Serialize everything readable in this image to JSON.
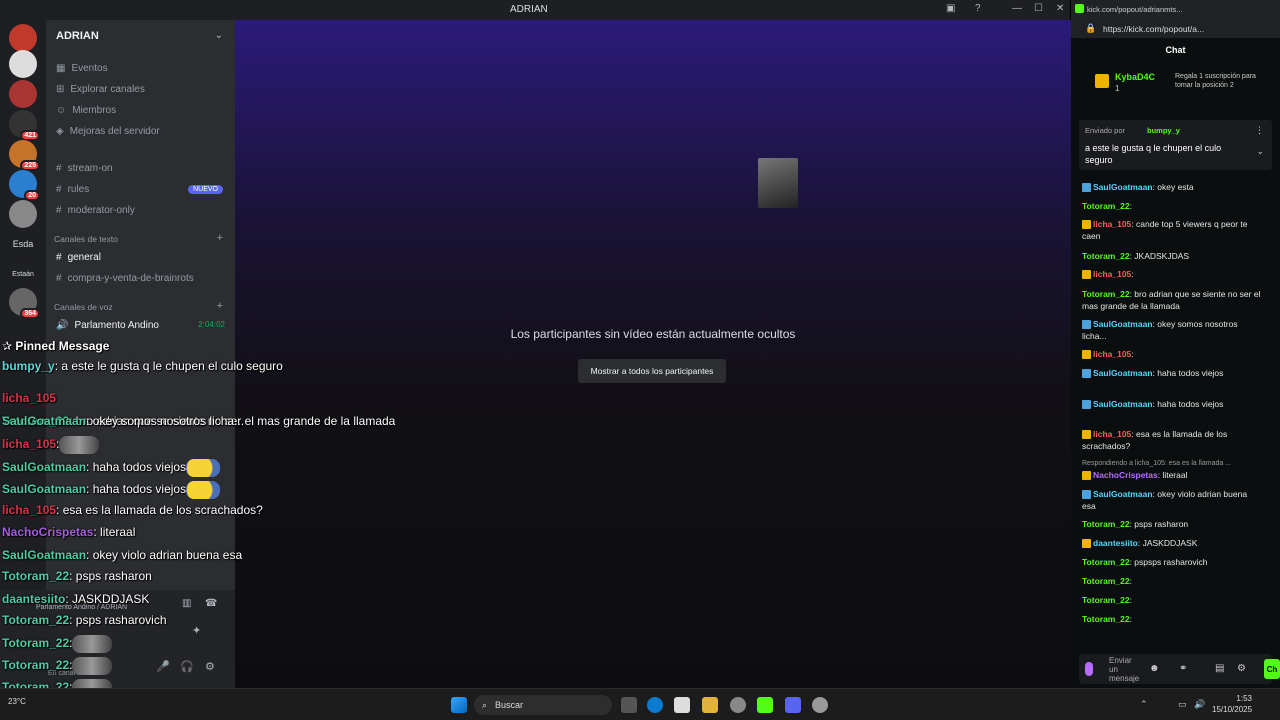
{
  "window": {
    "title": "ADRIAN"
  },
  "rail": {
    "badges": [
      "421",
      "225",
      "20",
      "364"
    ],
    "labels": [
      "Esda",
      "Estaán"
    ]
  },
  "sidebar": {
    "server_name": "ADRIAN",
    "top_items": [
      "Eventos",
      "Explorar canales",
      "Miembros",
      "Mejoras del servidor"
    ],
    "channels": [
      "stream-on",
      "rules",
      "moderator-only"
    ],
    "new_badge": "NUEVO",
    "text_category": "Canales de texto",
    "text_channels": [
      "general",
      "compra-y-venta-de-brainrots"
    ],
    "voice_category": "Canales de voz",
    "voice_channel": "Parlamento Andino",
    "voice_timer": "2:04:02",
    "voice_status": "Parlamento Andino / ADRIAN",
    "voice_sub": "En canal de voz"
  },
  "main": {
    "hidden_text": "Los participantes sin vídeo están actualmente ocultos",
    "show_button": "Mostrar a todos los participantes"
  },
  "overlay": {
    "title": "Pinned Message",
    "lines": [
      {
        "user": "bumpy_y",
        "cls": "u-b",
        "text": ": a este le gusta q le chupen el culo seguro"
      },
      {
        "user": "licha_105",
        "cls": "u-l",
        "text": ""
      },
      {
        "user": "Totoram_22",
        "cls": "u-t",
        "text": ": bro adrian que se siente no ser el mas grande de la llamada"
      },
      {
        "user": "SaulGoatmaan",
        "cls": "u-s",
        "text": ": okey somos nosotros licha..."
      },
      {
        "user": "licha_105",
        "cls": "u-l",
        "text": ":"
      },
      {
        "user": "SaulGoatmaan",
        "cls": "u-s",
        "text": ": haha todos viejos"
      },
      {
        "user": "SaulGoatmaan",
        "cls": "u-s",
        "text": ": haha todos viejos"
      },
      {
        "user": "licha_105",
        "cls": "u-l",
        "text": ": esa es la llamada de los scrachados?"
      },
      {
        "user": "NachoCrispetas",
        "cls": "u-n",
        "text": ": literaal"
      },
      {
        "user": "SaulGoatmaan",
        "cls": "u-s",
        "text": ": okey violo adrian buena esa"
      },
      {
        "user": "Totoram_22",
        "cls": "u-t",
        "text": ": psps rasharon"
      },
      {
        "user": "daantesiito",
        "cls": "u-d",
        "text": ": JASKDDJASK"
      },
      {
        "user": "Totoram_22",
        "cls": "u-t",
        "text": ": psps rasharovich"
      },
      {
        "user": "Totoram_22",
        "cls": "u-t",
        "text": ":"
      },
      {
        "user": "Totoram_22",
        "cls": "u-t",
        "text": ":"
      },
      {
        "user": "Totoram_22",
        "cls": "u-t",
        "text": ":"
      }
    ]
  },
  "kick": {
    "url": "https://kick.com/popout/a...",
    "tab_title": "kick.com/popout/adrianmts...",
    "header": "Chat",
    "top_user": "KybaD4C",
    "top_count": "1",
    "gift_text": "Regala 1 suscripción para tomar la posición 2",
    "pinned_by_label": "Enviado por",
    "pinned_by": "bumpy_y",
    "pinned_text": "a este le gusta q le chupen el culo seguro",
    "messages": [
      {
        "user": "SaulGoatmaan",
        "cls": "kn-s",
        "icon": "blue",
        "text": ": okey esta"
      },
      {
        "user": "Totoram_22",
        "cls": "kn-t",
        "icon": "",
        "text": ":"
      },
      {
        "user": "licha_105",
        "cls": "kn-l",
        "icon": "gold",
        "text": ": cande top 5 viewers q peor te caen"
      },
      {
        "user": "Totoram_22",
        "cls": "kn-t",
        "icon": "",
        "text": ": JKADSKJDAS"
      },
      {
        "user": "licha_105",
        "cls": "kn-l",
        "icon": "gold",
        "text": ":"
      },
      {
        "user": "Totoram_22",
        "cls": "kn-t",
        "icon": "",
        "text": ": bro adrian que se siente no ser el mas grande de la llamada"
      },
      {
        "user": "SaulGoatmaan",
        "cls": "kn-s",
        "icon": "blue",
        "text": ": okey somos nosotros licha..."
      },
      {
        "user": "licha_105",
        "cls": "kn-l",
        "icon": "gold",
        "text": ":"
      },
      {
        "user": "SaulGoatmaan",
        "cls": "kn-s",
        "icon": "blue",
        "text": ": haha todos viejos"
      },
      {
        "user": "SaulGoatmaan",
        "cls": "kn-s",
        "icon": "blue",
        "text": ": haha todos viejos"
      },
      {
        "user": "licha_105",
        "cls": "kn-l",
        "icon": "gold",
        "text": ": esa es la llamada de los scrachados?"
      },
      {
        "user": "NachoCrispetas",
        "cls": "kn-n",
        "icon": "gold",
        "text": ": literaal"
      },
      {
        "user": "SaulGoatmaan",
        "cls": "kn-s",
        "icon": "blue",
        "text": ": okey violo adrian buena esa"
      },
      {
        "user": "Totoram_22",
        "cls": "kn-t",
        "icon": "",
        "text": ": psps rasharon"
      },
      {
        "user": "daantesiito",
        "cls": "kn-d",
        "icon": "gold",
        "text": ": JASKDDJASK"
      },
      {
        "user": "Totoram_22",
        "cls": "kn-t",
        "icon": "",
        "text": ": pspsps rasharovich"
      },
      {
        "user": "Totoram_22",
        "cls": "kn-t",
        "icon": "",
        "text": ":"
      },
      {
        "user": "Totoram_22",
        "cls": "kn-t",
        "icon": "",
        "text": ":"
      },
      {
        "user": "Totoram_22",
        "cls": "kn-t",
        "icon": "",
        "text": ":"
      }
    ],
    "reply_note": "Respondiendo a licha_105: esa es la llamada ...",
    "input_placeholder": "Enviar un mensaje",
    "chat_button": "Ch"
  },
  "taskbar": {
    "search": "Buscar",
    "weather": "23°C",
    "time": "1:53",
    "date": "15/10/2025"
  }
}
